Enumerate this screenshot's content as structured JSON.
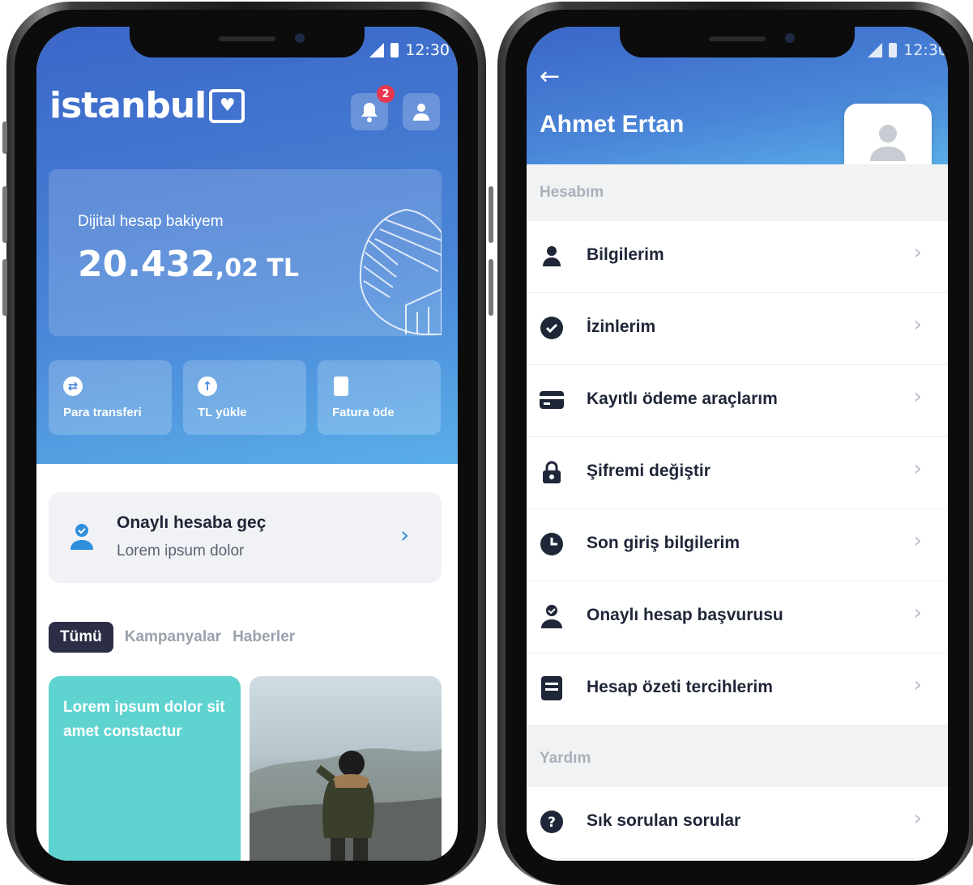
{
  "status": {
    "time": "12:30"
  },
  "left": {
    "logo": "istanbul",
    "notification_count": "2",
    "balance": {
      "label": "Dijital hesap bakiyem",
      "amount_int": "20.432",
      "amount_dec": ",02 TL"
    },
    "actions": [
      {
        "label": "Para transferi",
        "icon": "transfer-icon"
      },
      {
        "label": "TL yükle",
        "icon": "upload-icon"
      },
      {
        "label": "Fatura öde",
        "icon": "document-icon"
      }
    ],
    "verify": {
      "title": "Onaylı hesaba geç",
      "subtitle": "Lorem ipsum dolor"
    },
    "tabs": [
      "Tümü",
      "Kampanyalar",
      "Haberler"
    ],
    "card_text": "Lorem ipsum dolor sit amet constactur",
    "colors": {
      "accent": "#2e8fdc",
      "card": "#5fd3d0",
      "tab_active": "#2b2e45"
    }
  },
  "right": {
    "name": "Ahmet Ertan",
    "sections": [
      {
        "title": "Hesabım",
        "items": [
          {
            "label": "Bilgilerim",
            "icon": "person-icon"
          },
          {
            "label": "İzinlerim",
            "icon": "check-circle-icon"
          },
          {
            "label": "Kayıtlı ödeme araçlarım",
            "icon": "card-icon"
          },
          {
            "label": "Şifremi değiştir",
            "icon": "lock-icon"
          },
          {
            "label": "Son giriş bilgilerim",
            "icon": "clock-icon"
          },
          {
            "label": "Onaylı hesap başvurusu",
            "icon": "verified-user-icon"
          },
          {
            "label": "Hesap özeti tercihlerim",
            "icon": "statement-icon"
          }
        ]
      },
      {
        "title": "Yardım",
        "items": [
          {
            "label": "Sık sorulan sorular",
            "icon": "help-icon"
          }
        ]
      }
    ]
  }
}
